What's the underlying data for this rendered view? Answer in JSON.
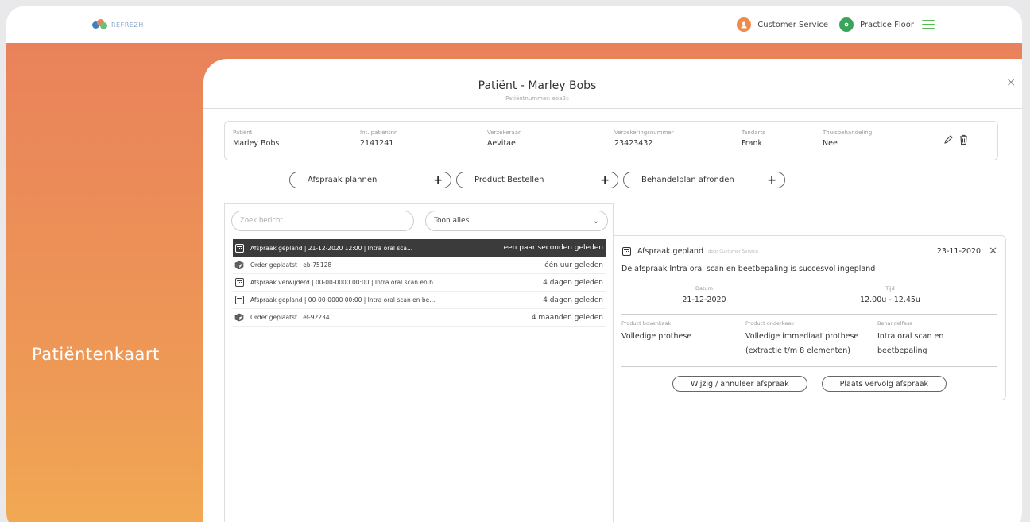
{
  "app": {
    "logo_text": "REFREZH",
    "brand_colors": [
      "#3c7fc4",
      "#e9825a",
      "#6cc07a"
    ]
  },
  "header": {
    "customer_service_label": "Customer Service",
    "practice_floor_label": "Practice Floor",
    "user_icon": "user-circle-icon",
    "location_icon": "location-pin-icon",
    "menu_icon": "hamburger-menu-icon",
    "accent_orange": "#ee8a4a",
    "accent_green": "#4caf50"
  },
  "sidebar": {
    "title": "Patiëntenkaart"
  },
  "modal": {
    "title": "Patiënt - Marley Bobs",
    "subtitle": "Patiëntnummer: eba2c",
    "close": "×"
  },
  "patient_info": {
    "fields": [
      {
        "label": "Patiënt",
        "value": "Marley Bobs"
      },
      {
        "label": "Int. patiëntnr",
        "value": "2141241"
      },
      {
        "label": "Verzekeraar",
        "value": "Aevitae"
      },
      {
        "label": "Verzekeringsnummer",
        "value": "23423432"
      },
      {
        "label": "Tandarts",
        "value": "Frank"
      },
      {
        "label": "Thuisbehandeling",
        "value": "Nee"
      }
    ],
    "edit_icon": "pencil-icon",
    "delete_icon": "trash-icon"
  },
  "actions": {
    "plan_appointment": "Afspraak plannen",
    "order_product": "Product Bestellen",
    "finish_treatment_plan": "Behandelplan afronden",
    "plus": "+"
  },
  "messages": {
    "search_placeholder": "Zoek bericht...",
    "filter_value": "Toon alles",
    "filter_chevron": "⌄",
    "items": [
      {
        "icon": "calendar-icon",
        "text": "Afspraak gepland | 21-12-2020 12:00 | Intra oral sca...",
        "time": "een paar seconden geleden",
        "active": true
      },
      {
        "icon": "box-icon",
        "text": "Order geplaatst | eb-75128",
        "time": "één uur geleden",
        "active": false
      },
      {
        "icon": "calendar-icon",
        "text": "Afspraak verwijderd | 00-00-0000 00:00 | Intra oral scan en b...",
        "time": "4 dagen geleden",
        "active": false
      },
      {
        "icon": "calendar-icon",
        "text": "Afspraak gepland | 00-00-0000 00:00 | Intra oral scan en be...",
        "time": "4 dagen geleden",
        "active": false
      },
      {
        "icon": "box-icon",
        "text": "Order geplaatst | ef-92234",
        "time": "4 maanden geleden",
        "active": false
      }
    ]
  },
  "detail": {
    "title": "Afspraak gepland",
    "by": "door Customer Service",
    "date": "23-11-2020",
    "close": "✕",
    "message": "De afspraak Intra oral scan en beetbepaling is succesvol ingepland",
    "datum_label": "Datum",
    "datum_value": "21-12-2020",
    "tijd_label": "Tijd",
    "tijd_value": "12.00u - 12.45u",
    "upper_label": "Product bovenkaak",
    "upper_value": "Volledige prothese",
    "lower_label": "Product onderkaak",
    "lower_value": "Volledige immediaat prothese (extractie t/m 8 elementen)",
    "phase_label": "Behandelfase",
    "phase_value": "Intra oral scan en beetbepaling",
    "change_button": "Wijzig / annuleer afspraak",
    "follow_up_button": "Plaats vervolg afspraak"
  }
}
